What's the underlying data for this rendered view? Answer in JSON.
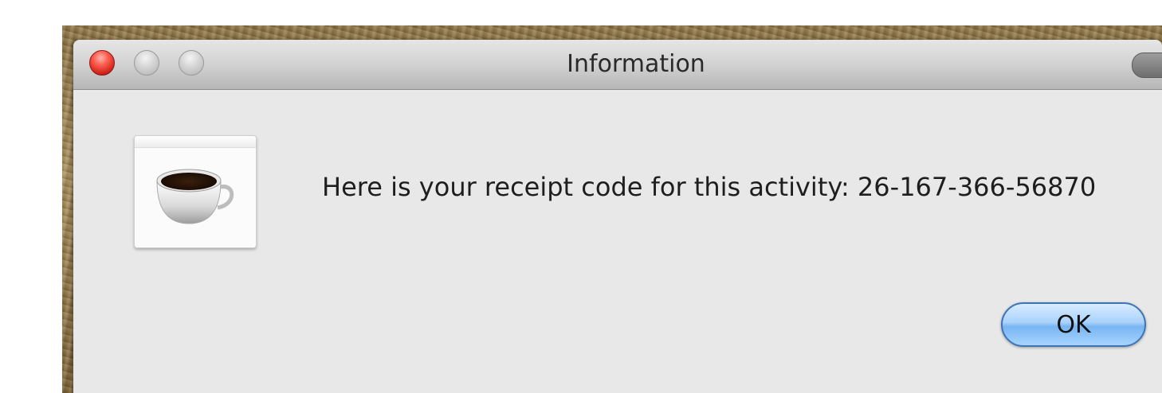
{
  "window": {
    "title": "Information"
  },
  "dialog": {
    "icon": "java-coffee-cup-icon",
    "message": "Here is your receipt code for this activity: 26-167-366-56870",
    "ok_label": "OK"
  },
  "colors": {
    "close_button": "#ff5b4e",
    "ok_button": "#78b5f1",
    "dialog_background": "#e8e8e8"
  }
}
